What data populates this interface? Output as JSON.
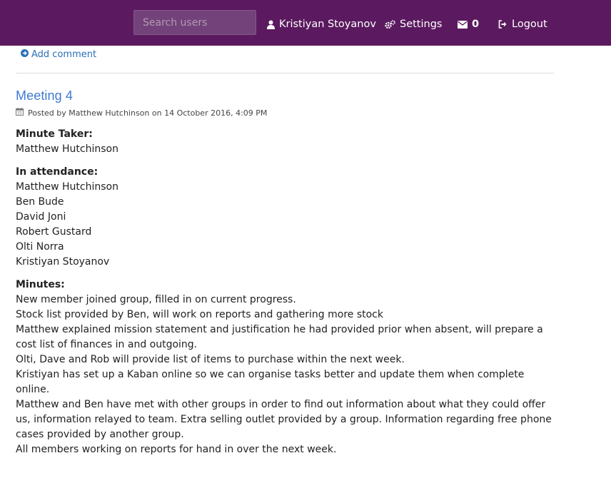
{
  "header": {
    "search_placeholder": "Search users",
    "user_name": "Kristiyan Stoyanov",
    "settings_label": "Settings",
    "messages_count": "0",
    "logout_label": "Logout",
    "background_color": "#5b1a5f"
  },
  "actions": {
    "add_comment_label": "Add comment"
  },
  "post": {
    "title": "Meeting 4",
    "meta": "Posted by Matthew Hutchinson on 14 October 2016, 4:09 PM",
    "minute_taker_label": "Minute Taker:",
    "minute_taker": "Matthew Hutchinson",
    "attendance_label": "In attendance:",
    "attendees": [
      "Matthew Hutchinson",
      "Ben Bude",
      "David Joni",
      "Robert Gustard",
      "Olti Norra",
      "Kristiyan Stoyanov"
    ],
    "minutes_label": "Minutes:",
    "minutes": [
      "New member joined group, filled in on current progress.",
      "Stock list provided by Ben, will work on reports and gathering more stock",
      "Matthew explained mission statement and justification he had provided prior when absent, will prepare a cost list of finances in and outgoing.",
      "Olti, Dave and Rob will provide list of items to purchase within the next week.",
      "Kristiyan has set up a Kaban online so we can organise tasks better and update them when complete online.",
      "Matthew and Ben have met with other groups in order to find out information about what they could offer us, information relayed to team. Extra selling outlet provided by a group. Information regarding free phone cases provided by another group.",
      "All members working on reports for hand in over the next week."
    ]
  }
}
